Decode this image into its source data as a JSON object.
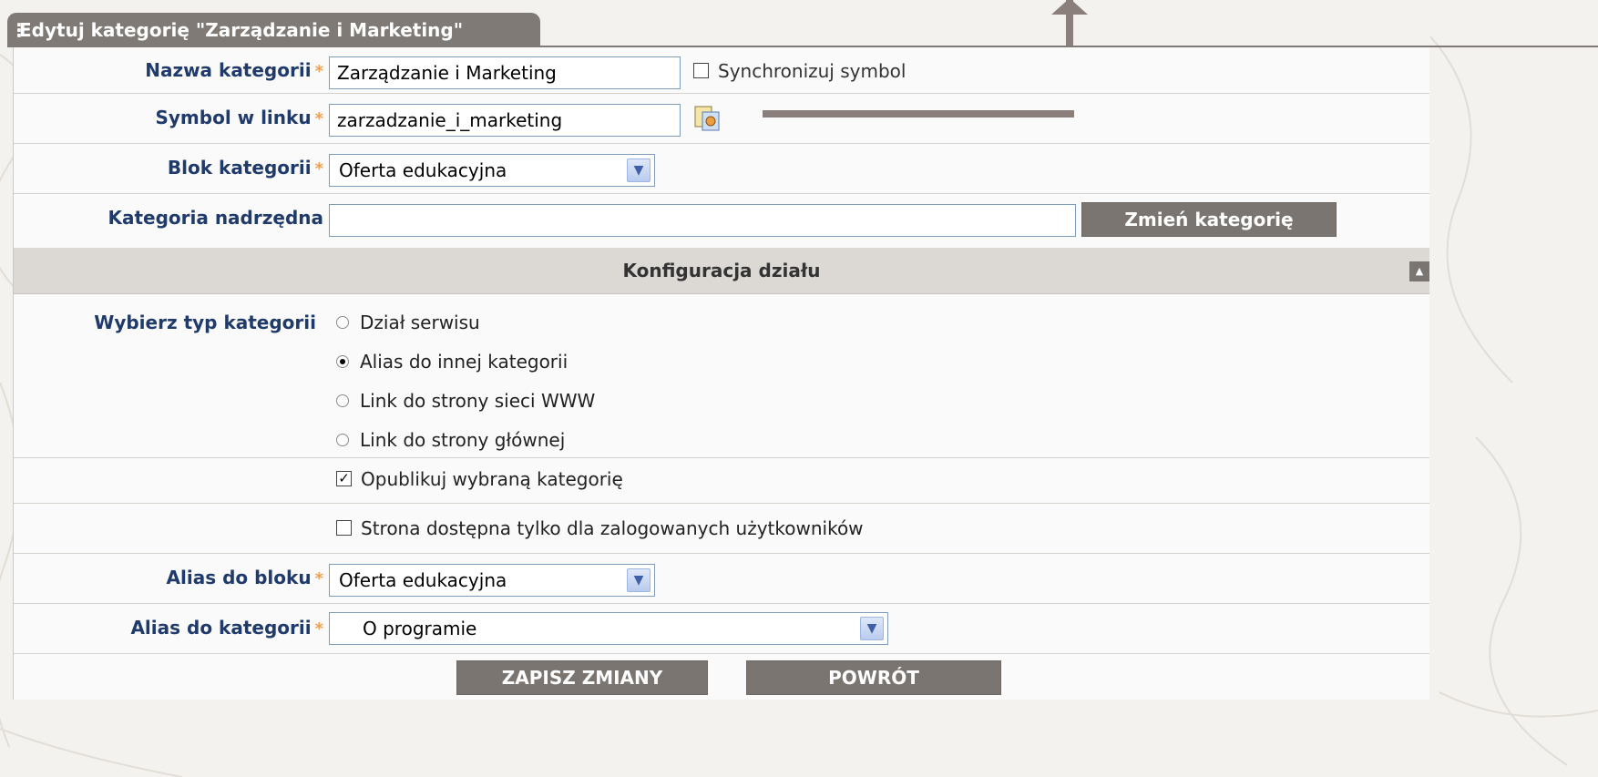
{
  "tab_title": "Edytuj kategorię \"Zarządzanie i Marketing\"",
  "fields": {
    "nazwa": {
      "label": "Nazwa kategorii",
      "value": "Zarządzanie i Marketing",
      "required": "*"
    },
    "sync": {
      "label": "Synchronizuj symbol",
      "checked": false
    },
    "symbol": {
      "label": "Symbol w linku",
      "value": "zarzadzanie_i_marketing",
      "required": "*"
    },
    "blok": {
      "label": "Blok kategorii",
      "value": "Oferta edukacyjna",
      "required": "*"
    },
    "nadrzedna": {
      "label": "Kategoria nadrzędna",
      "value": "",
      "button": "Zmień kategorię"
    }
  },
  "section": {
    "title": "Konfiguracja działu"
  },
  "type": {
    "label": "Wybierz typ kategorii",
    "options": [
      "Dział serwisu",
      "Alias do innej kategorii",
      "Link do strony sieci WWW",
      "Link do strony głównej"
    ],
    "selected": "Alias do innej kategorii"
  },
  "publish": {
    "label": "Opublikuj wybraną kategorię",
    "checked": true
  },
  "logged_only": {
    "label": "Strona dostępna tylko dla zalogowanych użytkowników",
    "checked": false
  },
  "alias_blok": {
    "label": "Alias do bloku",
    "value": "Oferta edukacyjna",
    "required": "*"
  },
  "alias_kat": {
    "label": "Alias do kategorii",
    "value": "O programie",
    "required": "*"
  },
  "buttons": {
    "save": "ZAPISZ ZMIANY",
    "back": "POWRÓT"
  },
  "colors": {
    "label_text": "#1f3a6b",
    "button_bg": "#7a7571",
    "required_star": "#f0a050",
    "annotation_arrow": "#8a7f7a"
  }
}
